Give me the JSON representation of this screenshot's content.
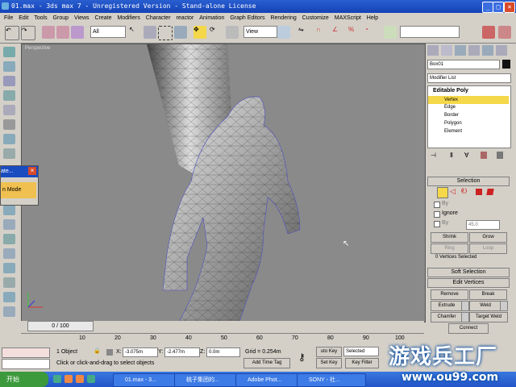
{
  "window": {
    "title": "01.max - 3ds max 7 - Unregistered Version - Stand-alone License"
  },
  "menu": [
    "File",
    "Edit",
    "Tools",
    "Group",
    "Views",
    "Create",
    "Modifiers",
    "Character",
    "reactor",
    "Animation",
    "Graph Editors",
    "Rendering",
    "Customize",
    "MAXScript",
    "Help"
  ],
  "toolbar": {
    "selection_filter": "All",
    "reference_coord": "View"
  },
  "viewport": {
    "label": "Perspective"
  },
  "popup": {
    "title": "ate...",
    "text": "n Mode"
  },
  "panel": {
    "object_name": "Box01",
    "modifier_list": "Modifier List",
    "stack": [
      "Editable Poly",
      "Vertex",
      "Edge",
      "Border",
      "Polygon",
      "Element"
    ],
    "selected_stack": "Vertex",
    "selection_title": "Selection",
    "by_label": "By",
    "ignore_label": "Ignore",
    "by_angle_label": "By",
    "by_angle_value": "45.0",
    "shrink": "Shrink",
    "grow": "Grow",
    "ring": "Ring",
    "loop": "Loop",
    "vertices_selected": "0 Vertices Selected",
    "soft_selection": "Soft Selection",
    "edit_vertices": "Edit Vertices",
    "remove": "Remove",
    "break": "Break",
    "extrude": "Extrude",
    "weld": "Weld",
    "chamfer": "Chamfer",
    "target_weld": "Target Weld",
    "connect": "Connect"
  },
  "timeline": {
    "slider": "0 / 100"
  },
  "ruler": {
    "ticks": [
      "10",
      "20",
      "30",
      "40",
      "50",
      "60",
      "70",
      "80",
      "90",
      "100"
    ]
  },
  "status": {
    "objects": "1 Object",
    "x_label": "X:",
    "x": "-3.075m",
    "y_label": "Y:",
    "y": "-2.477m",
    "z_label": "Z:",
    "z": "0.0m",
    "grid": "Grid = 0.254m",
    "autokey": "uto Key",
    "selected": "Selected",
    "set_key": "Set Key",
    "key_filter": "Key Filter",
    "prompt": "Click or click-and-drag to select objects",
    "add_time_tag": "Add Time Tag"
  },
  "taskbar": {
    "start": "开始",
    "tasks": [
      "01.max - 3...",
      "桃子集团的...",
      "Adobe Phot...",
      "SONY - 社..."
    ]
  },
  "watermark": {
    "text": "游戏兵工厂",
    "url": "www.ou99.com"
  },
  "colors": {
    "title_bg": "#1442b8",
    "viewport_bg": "#8a8a8a",
    "highlight": "#f5d84a",
    "taskbar": "#2255c8"
  }
}
